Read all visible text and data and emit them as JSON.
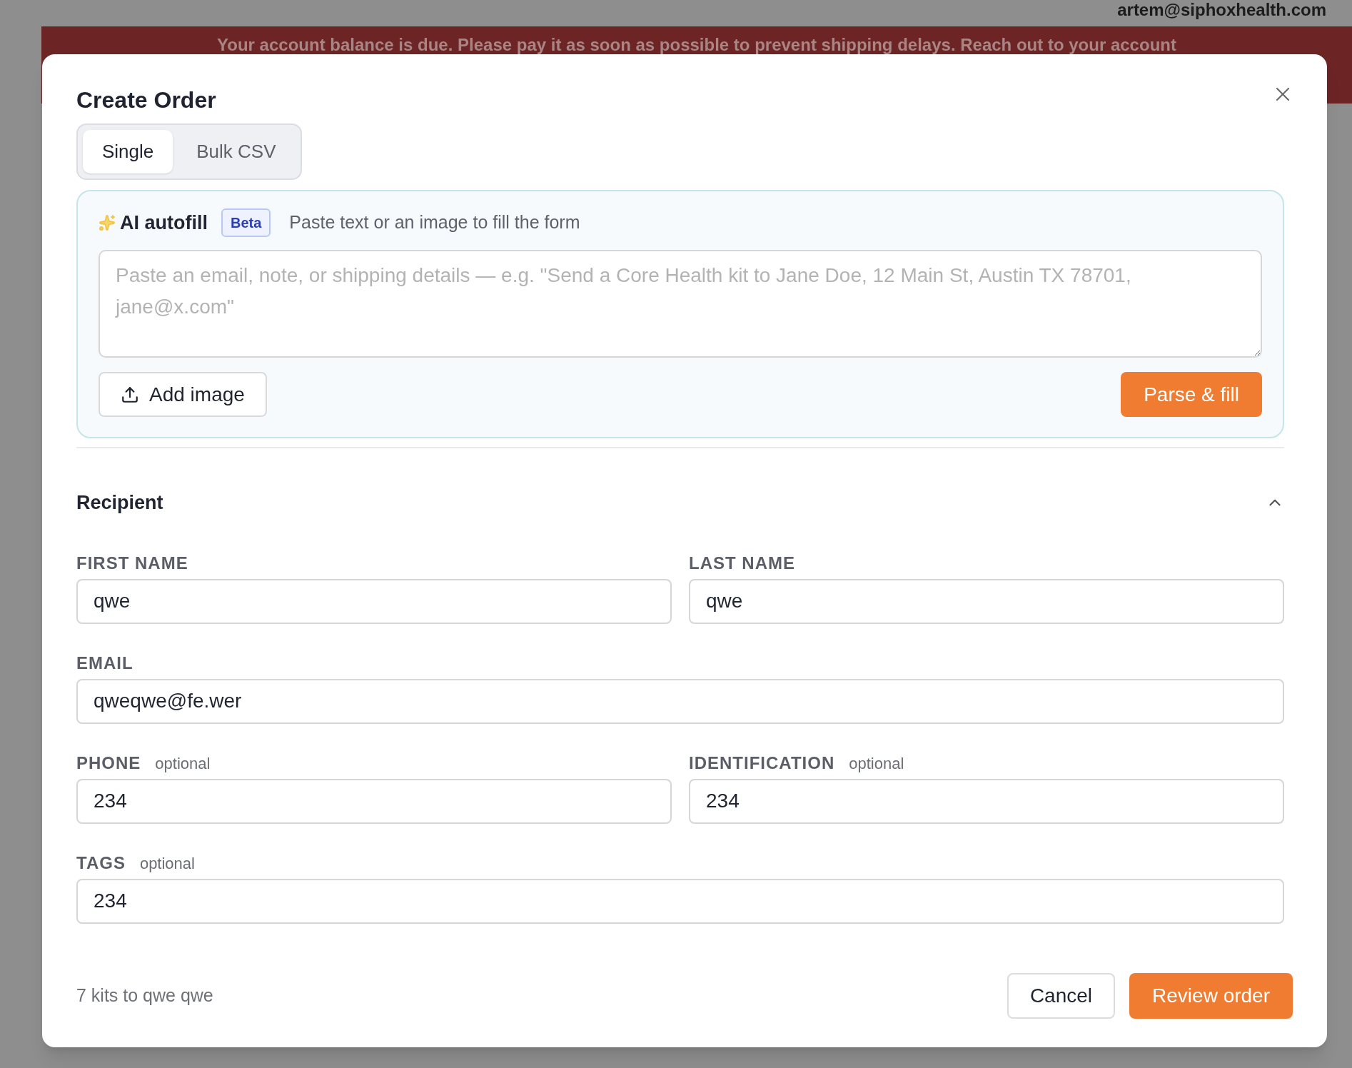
{
  "header": {
    "email": "artem@siphoxhealth.com"
  },
  "banner": {
    "text": "Your account balance is due. Please pay it as soon as possible to prevent shipping delays. Reach out to your account"
  },
  "dialog": {
    "title": "Create Order",
    "tabs": [
      {
        "label": "Single",
        "selected": true
      },
      {
        "label": "Bulk CSV",
        "selected": false
      }
    ],
    "autofill": {
      "title": "AI autofill",
      "badge": "Beta",
      "hint": "Paste text or an image to fill the form",
      "placeholder": "Paste an email, note, or shipping details — e.g. \"Send a Core Health kit to Jane Doe, 12 Main St, Austin TX 78701, jane@x.com\"",
      "add_button": "Add image",
      "parse_button": "Parse & fill"
    },
    "section": {
      "title": "Recipient",
      "expanded": true
    },
    "fields": [
      {
        "kind": "half",
        "label": "FIRST NAME",
        "value": "qwe"
      },
      {
        "kind": "half",
        "label": "LAST NAME",
        "value": "qwe"
      },
      {
        "kind": "full",
        "label": "EMAIL",
        "value": "qweqwe@fe.wer"
      },
      {
        "kind": "half",
        "label": "PHONE",
        "note": "optional",
        "value": "234"
      },
      {
        "kind": "half",
        "label": "IDENTIFICATION",
        "note": "optional",
        "value": "234"
      },
      {
        "kind": "full",
        "label": "TAGS",
        "note": "optional",
        "value": "234"
      }
    ],
    "summary": "7 kits to qwe qwe",
    "cancel_button": "Cancel",
    "submit_button": "Review order"
  }
}
